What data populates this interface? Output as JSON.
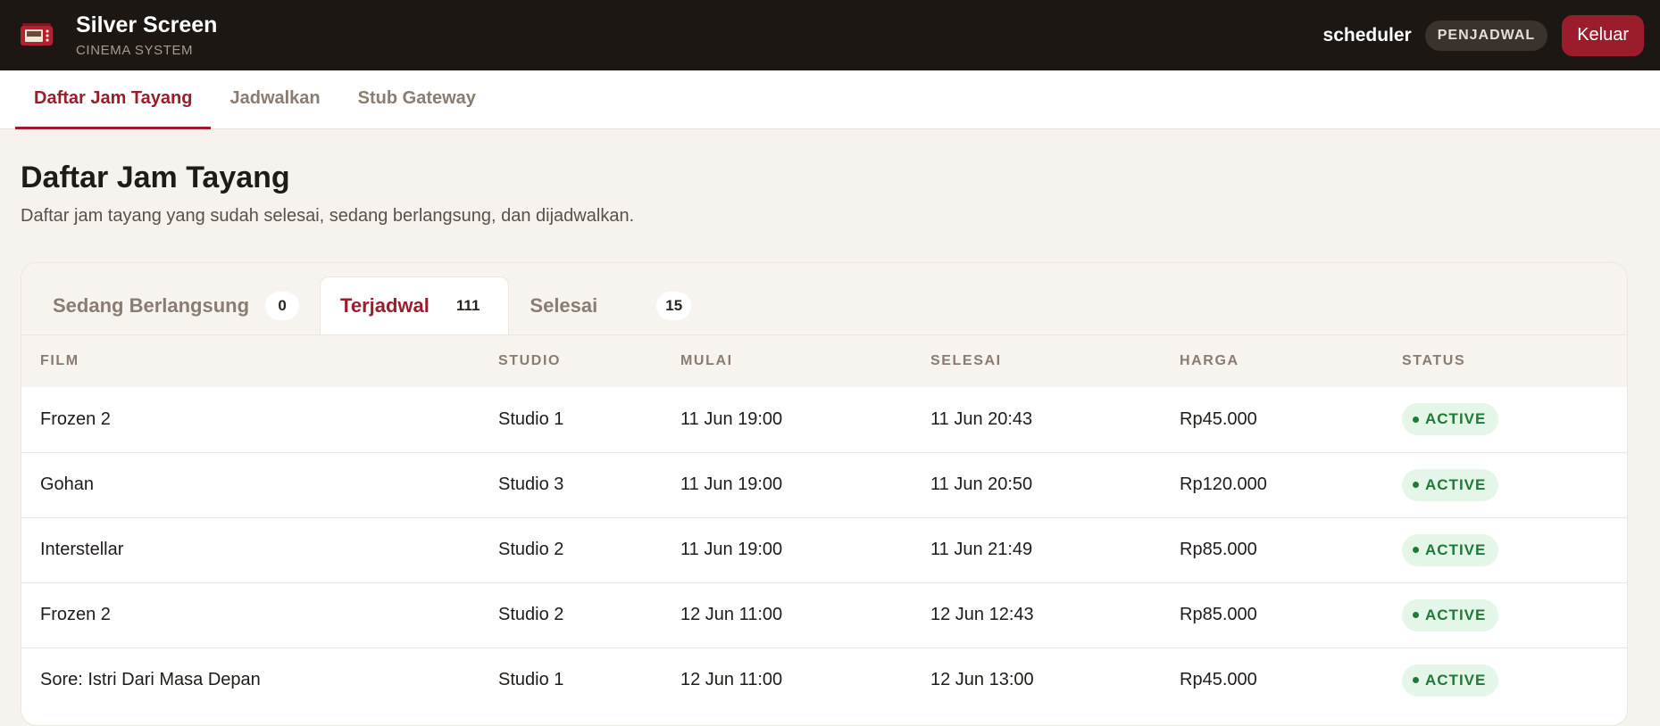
{
  "header": {
    "brand_title": "Silver Screen",
    "brand_subtitle": "CINEMA SYSTEM",
    "username": "scheduler",
    "role": "PENJADWAL",
    "logout_label": "Keluar",
    "logo_icon": "cinema-ticket-icon"
  },
  "nav": {
    "tabs": [
      {
        "label": "Daftar Jam Tayang",
        "active": true
      },
      {
        "label": "Jadwalkan",
        "active": false
      },
      {
        "label": "Stub Gateway",
        "active": false
      }
    ]
  },
  "page": {
    "title": "Daftar Jam Tayang",
    "description": "Daftar jam tayang yang sudah selesai, sedang berlangsung, dan dijadwalkan."
  },
  "status_tabs": [
    {
      "label": "Sedang Berlangsung",
      "count": "0",
      "active": false
    },
    {
      "label": "Terjadwal",
      "count": "111",
      "active": true
    },
    {
      "label": "Selesai",
      "count": "15",
      "active": false
    }
  ],
  "table": {
    "headers": [
      "FILM",
      "STUDIO",
      "MULAI",
      "SELESAI",
      "HARGA",
      "STATUS"
    ],
    "rows": [
      {
        "film": "Frozen 2",
        "studio": "Studio 1",
        "mulai": "11 Jun 19:00",
        "selesai": "11 Jun 20:43",
        "harga": "Rp45.000",
        "status": "ACTIVE"
      },
      {
        "film": "Gohan",
        "studio": "Studio 3",
        "mulai": "11 Jun 19:00",
        "selesai": "11 Jun 20:50",
        "harga": "Rp120.000",
        "status": "ACTIVE"
      },
      {
        "film": "Interstellar",
        "studio": "Studio 2",
        "mulai": "11 Jun 19:00",
        "selesai": "11 Jun 21:49",
        "harga": "Rp85.000",
        "status": "ACTIVE"
      },
      {
        "film": "Frozen 2",
        "studio": "Studio 2",
        "mulai": "12 Jun 11:00",
        "selesai": "12 Jun 12:43",
        "harga": "Rp85.000",
        "status": "ACTIVE"
      },
      {
        "film": "Sore: Istri Dari Masa Depan",
        "studio": "Studio 1",
        "mulai": "12 Jun 11:00",
        "selesai": "12 Jun 13:00",
        "harga": "Rp45.000",
        "status": "ACTIVE"
      }
    ]
  },
  "colors": {
    "accent": "#9b1d2c",
    "header_bg": "#1d1713",
    "status_active_bg": "#e3f6e8",
    "status_active_fg": "#1e7a37"
  }
}
